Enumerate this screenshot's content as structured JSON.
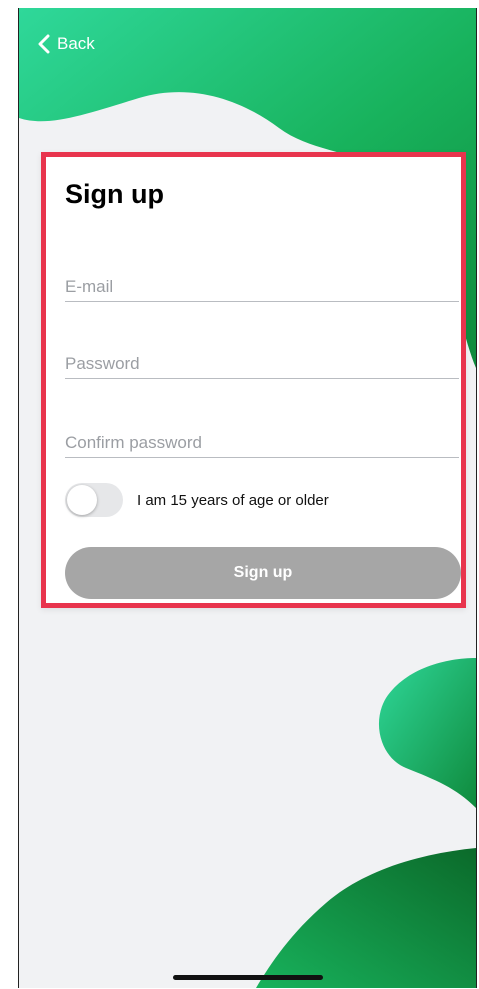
{
  "nav": {
    "back_label": "Back"
  },
  "form": {
    "title": "Sign up",
    "email_placeholder": "E-mail",
    "email_value": "",
    "password_placeholder": "Password",
    "password_value": "",
    "confirm_placeholder": "Confirm password",
    "confirm_value": "",
    "age_toggle_label": "I am 15 years of age or older",
    "age_toggle_on": false,
    "submit_label": "Sign up"
  },
  "icons": {
    "back": "chevron-left-icon",
    "home": "home-indicator"
  },
  "colors": {
    "highlight_border": "#e8344d",
    "brand_green_light": "#2fd89a",
    "brand_green_dark": "#0f8a3c",
    "button_disabled": "#a6a6a6",
    "background": "#f1f2f4"
  }
}
